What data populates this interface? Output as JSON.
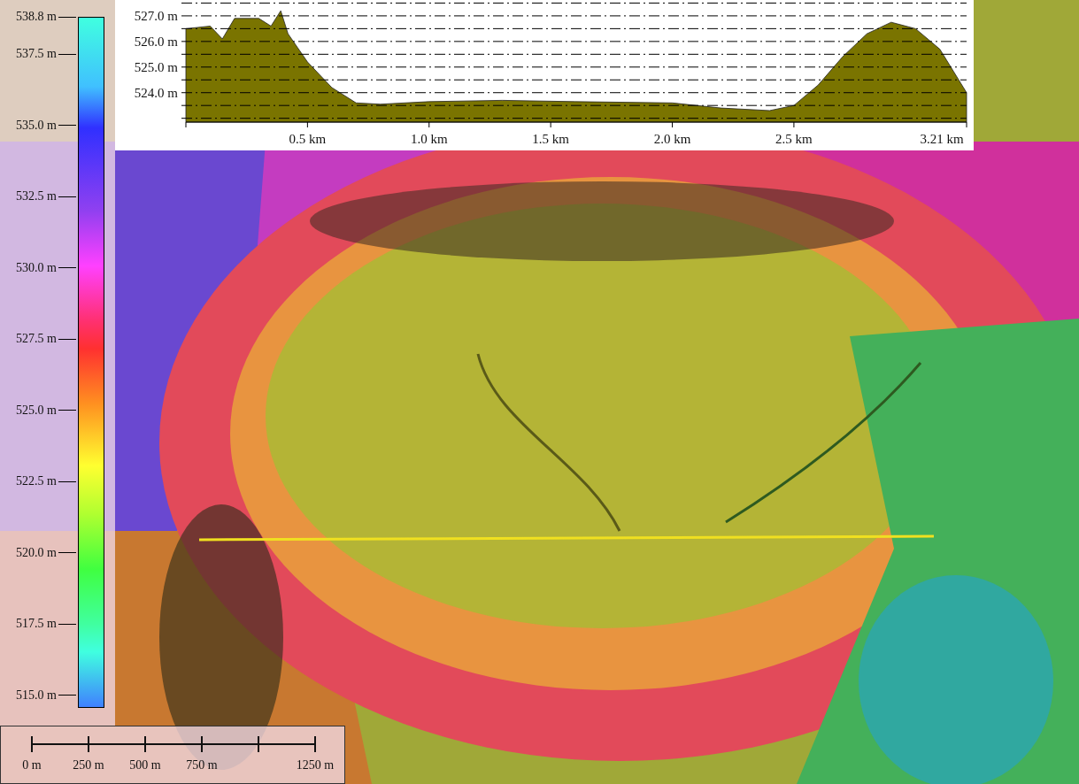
{
  "legend": {
    "ticks": [
      {
        "label": "538.8 m",
        "kind": "max"
      },
      {
        "label": "537.5 m",
        "kind": "step"
      },
      {
        "label": "535.0 m",
        "kind": "step"
      },
      {
        "label": "532.5 m",
        "kind": "step"
      },
      {
        "label": "530.0 m",
        "kind": "step"
      },
      {
        "label": "527.5 m",
        "kind": "step"
      },
      {
        "label": "525.0 m",
        "kind": "step"
      },
      {
        "label": "522.5 m",
        "kind": "step"
      },
      {
        "label": "520.0 m",
        "kind": "step"
      },
      {
        "label": "517.5 m",
        "kind": "step"
      },
      {
        "label": "515.0 m",
        "kind": "step"
      }
    ]
  },
  "profile": {
    "chart_data": {
      "type": "area",
      "x": [
        0,
        0.1,
        0.15,
        0.2,
        0.3,
        0.35,
        0.39,
        0.42,
        0.5,
        0.6,
        0.7,
        0.8,
        1.0,
        1.3,
        1.6,
        2.0,
        2.2,
        2.4,
        2.5,
        2.6,
        2.7,
        2.8,
        2.9,
        3.0,
        3.1,
        3.21
      ],
      "grid": true,
      "series": [
        {
          "color": "#7a7400",
          "values": [
            526.5,
            526.6,
            526.1,
            526.9,
            526.9,
            526.6,
            527.2,
            526.3,
            525.2,
            524.2,
            523.6,
            523.55,
            523.65,
            523.7,
            523.65,
            523.6,
            523.4,
            523.3,
            523.5,
            524.3,
            525.4,
            526.3,
            526.75,
            526.5,
            525.7,
            524.0
          ]
        }
      ],
      "xlim": [
        0,
        3.21
      ],
      "ylim": [
        522.85,
        527.55
      ],
      "xticks": [
        {
          "value": 0.5,
          "label": "0.5 km"
        },
        {
          "value": 1.0,
          "label": "1.0 km"
        },
        {
          "value": 1.5,
          "label": "1.5 km"
        },
        {
          "value": 2.0,
          "label": "2.0 km"
        },
        {
          "value": 2.5,
          "label": "2.5 km"
        },
        {
          "value": 3.21,
          "label": "3.21 km"
        }
      ],
      "yticks": [
        {
          "value": 524,
          "label": "524.0 m"
        },
        {
          "value": 525,
          "label": "525.0 m"
        },
        {
          "value": 526,
          "label": "526.0 m"
        },
        {
          "value": 527,
          "label": "527.0 m"
        }
      ]
    }
  },
  "scale_bar": {
    "ticks": [
      {
        "kind": "labeled",
        "label": "0 m"
      },
      {
        "kind": "labeled",
        "label": "250 m"
      },
      {
        "kind": "labeled",
        "label": "500 m"
      },
      {
        "kind": "labeled",
        "label": "750 m"
      },
      {
        "kind": "plain"
      },
      {
        "kind": "labeled",
        "label": "1250 m"
      }
    ]
  }
}
